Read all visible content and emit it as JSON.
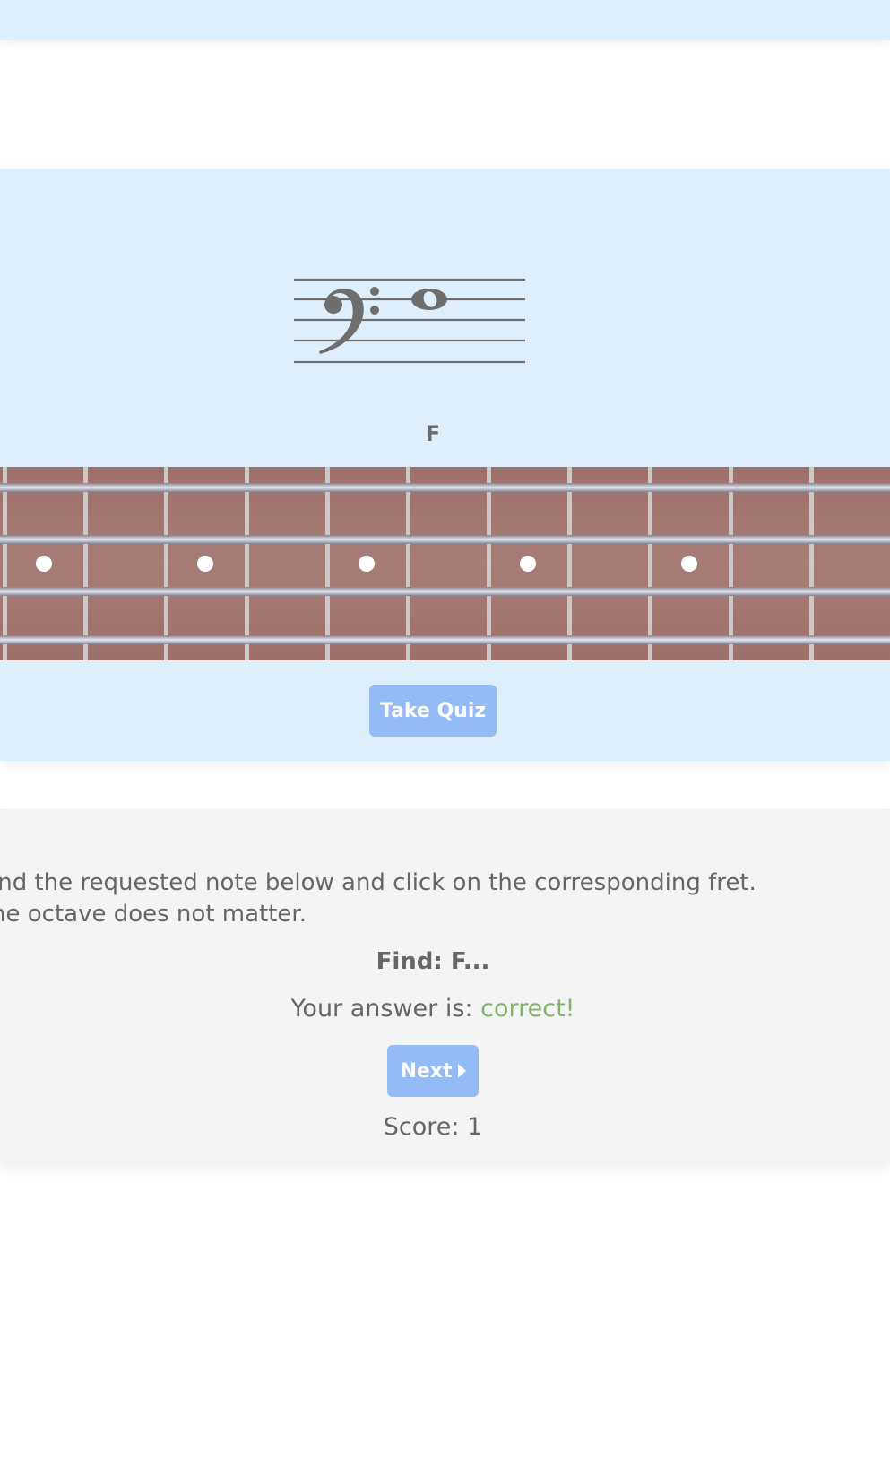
{
  "notation": {
    "clef": "bass-clef",
    "note_name": "F"
  },
  "fretboard": {
    "inlay_frets": [
      1,
      3,
      5,
      7,
      9
    ],
    "colors": {
      "wood": "#a27570",
      "fret": "#c9c9c9",
      "inlay": "#ffffff"
    }
  },
  "buttons": {
    "take_quiz": "Take Quiz",
    "next": "Next"
  },
  "quiz": {
    "instruction_line1": "ind the requested note below and click on the corresponding fret.",
    "instruction_line2": "he octave does not matter.",
    "find": "Find: F...",
    "answer_prefix": "Your answer is:",
    "answer_result": "correct!",
    "score": "Score: 1"
  },
  "colors": {
    "panel_blue": "#dfeefb",
    "panel_gray": "#f4f4f4",
    "button": "#93bcf7",
    "correct": "#82b36d",
    "text": "#666666"
  }
}
